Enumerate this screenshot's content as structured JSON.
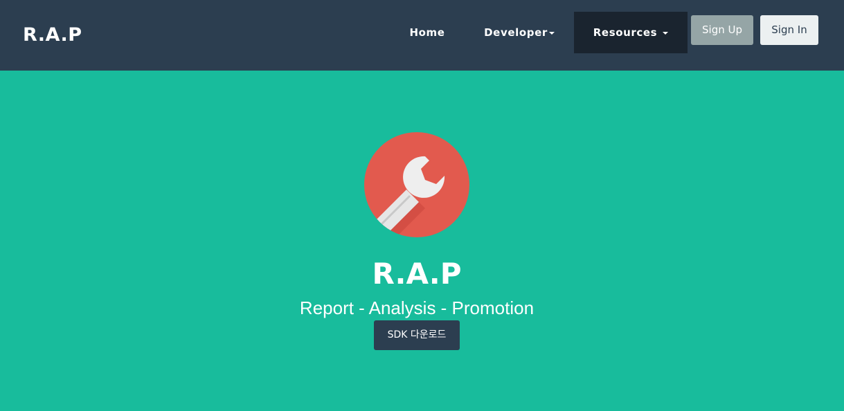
{
  "navbar": {
    "brand": "R.A.P",
    "items": [
      {
        "label": "Home"
      },
      {
        "label": "Developer"
      },
      {
        "label": "Resources"
      }
    ],
    "signup_label": "Sign Up",
    "signin_label": "Sign In"
  },
  "hero": {
    "logo_icon": "wrench-icon",
    "title": "R.A.P",
    "subtitle": "Report - Analysis - Promotion",
    "sdk_button_label": "SDK 다운로드"
  },
  "colors": {
    "navbar_bg": "#2c3e50",
    "active_nav_bg": "#1a242f",
    "page_bg": "#18bc9c",
    "logo_circle": "#e25a4e",
    "signup_bg": "#95a5a6",
    "signin_bg": "#ecf0f1"
  }
}
